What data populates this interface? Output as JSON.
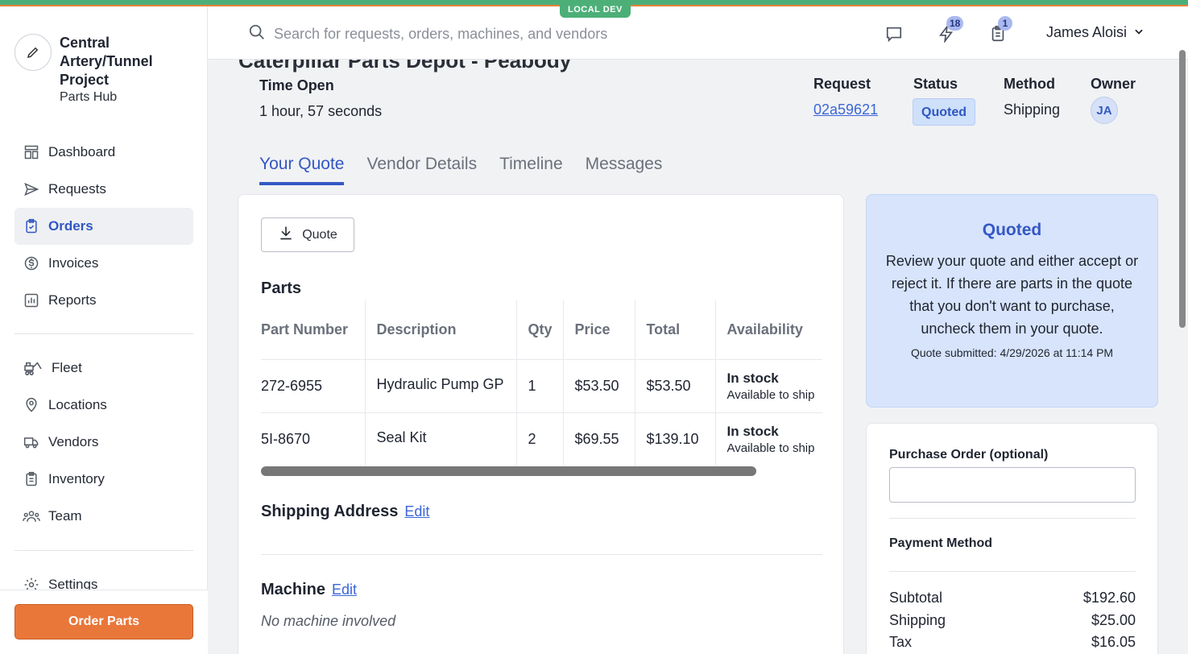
{
  "env_badge": "LOCAL DEV",
  "org": {
    "name": "Central Artery/Tunnel Project",
    "subtitle": "Parts Hub"
  },
  "nav": {
    "primary": [
      {
        "label": "Dashboard",
        "icon": "dashboard-icon"
      },
      {
        "label": "Requests",
        "icon": "send-icon"
      },
      {
        "label": "Orders",
        "icon": "clipboard-check-icon",
        "active": true
      },
      {
        "label": "Invoices",
        "icon": "dollar-icon"
      },
      {
        "label": "Reports",
        "icon": "chart-icon"
      }
    ],
    "secondary": [
      {
        "label": "Fleet",
        "icon": "excavator-icon"
      },
      {
        "label": "Locations",
        "icon": "pin-icon"
      },
      {
        "label": "Vendors",
        "icon": "truck-icon"
      },
      {
        "label": "Inventory",
        "icon": "clipboard-icon"
      },
      {
        "label": "Team",
        "icon": "team-icon"
      }
    ],
    "settings": "Settings"
  },
  "order_parts_label": "Order Parts",
  "search": {
    "placeholder": "Search for requests, orders, machines, and vendors"
  },
  "header": {
    "activity_count": "18",
    "tasks_count": "1",
    "user_name": "James Aloisi"
  },
  "page": {
    "title_partial": "Caterpillar Parts Depot - Peabody",
    "time_open_label": "Time Open",
    "time_open_value": "1 hour, 57 seconds",
    "request_label": "Request",
    "request_value": "02a59621",
    "status_label": "Status",
    "status_value": "Quoted",
    "method_label": "Method",
    "method_value": "Shipping",
    "owner_label": "Owner",
    "owner_initials": "JA"
  },
  "tabs": [
    "Your Quote",
    "Vendor Details",
    "Timeline",
    "Messages"
  ],
  "quote_button": "Quote",
  "parts": {
    "title": "Parts",
    "columns": [
      "Part Number",
      "Description",
      "Qty",
      "Price",
      "Total",
      "Availability"
    ],
    "rows": [
      {
        "part_number": "272-6955",
        "description": "Hydraulic Pump GP",
        "qty": "1",
        "price": "$53.50",
        "total": "$53.50",
        "availability": "In stock",
        "availability_note": "Available to ship"
      },
      {
        "part_number": "5I-8670",
        "description": "Seal Kit",
        "qty": "2",
        "price": "$69.55",
        "total": "$139.10",
        "availability": "In stock",
        "availability_note": "Available to ship"
      }
    ]
  },
  "shipping": {
    "title": "Shipping Address",
    "edit": "Edit"
  },
  "machine": {
    "title": "Machine",
    "edit": "Edit",
    "empty": "No machine involved"
  },
  "status_card": {
    "title": "Quoted",
    "body": "Review your quote and either accept or reject it. If there are parts in the quote that you don't want to purchase, uncheck them in your quote.",
    "submitted": "Quote submitted: 4/29/2026 at 11:14 PM"
  },
  "payment": {
    "po_label": "Purchase Order (optional)",
    "method_label": "Payment Method",
    "subtotal_label": "Subtotal",
    "subtotal": "$192.60",
    "shipping_label": "Shipping",
    "shipping": "$25.00",
    "tax_label": "Tax",
    "tax": "$16.05"
  }
}
